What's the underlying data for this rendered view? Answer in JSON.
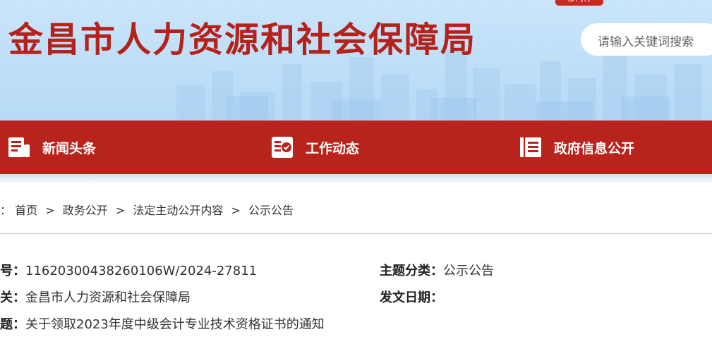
{
  "header": {
    "site_title": "金昌市人力资源和社会保障局",
    "corner_tag": "部门行",
    "search_placeholder": "请输入关键词搜索"
  },
  "nav": {
    "items": [
      {
        "label": "新闻头条",
        "icon": "newspaper-icon"
      },
      {
        "label": "工作动态",
        "icon": "checklist-icon"
      },
      {
        "label": "政府信息公开",
        "icon": "document-list-icon"
      }
    ]
  },
  "breadcrumb": {
    "prefix": "：",
    "items": [
      "首页",
      "政务公开",
      "法定主动公开内容",
      "公示公告"
    ],
    "separator": ">"
  },
  "meta": {
    "index_no": {
      "key": "号：",
      "value": "11620300438260106W/2024-27811"
    },
    "issuer": {
      "key": "关：",
      "value": "金昌市人力资源和社会保障局"
    },
    "title": {
      "key": "题：",
      "value": "关于领取2023年度中级会计专业技术资格证书的通知"
    },
    "category": {
      "key": "主题分类：",
      "value": "公示公告"
    },
    "date": {
      "key": "发文日期：",
      "value": ""
    }
  },
  "colors": {
    "brand_red": "#b8231c",
    "title_red": "#b3221b",
    "banner_blue": "#c9e5fb"
  }
}
